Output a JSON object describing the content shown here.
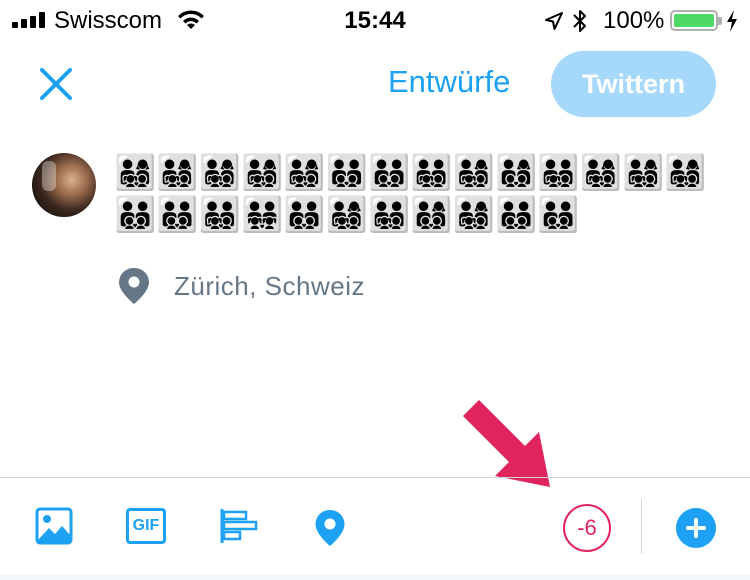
{
  "status_bar": {
    "carrier": "Swisscom",
    "time": "15:44",
    "battery": "100%"
  },
  "header": {
    "drafts_label": "Entwürfe",
    "tweet_button_label": "Twittern"
  },
  "compose": {
    "tweet_text": "👨‍👩‍👧‍👦👨‍👩‍👧‍👦👨‍👩‍👧‍👦👨‍👩‍👧‍👦👨‍👩‍👧‍👦👨‍👨‍👦‍👦👨‍👨‍👦‍👦👨‍👨‍👧‍👦👨‍👩‍👧‍👦👨‍👩‍👦‍👦👨‍👨‍👧‍👦👨‍👩‍👧‍👦👨‍👩‍👧‍👦👨‍👩‍👧‍👦👨‍👨‍👦‍👦👨‍👨‍👦‍👦👨‍👨‍👧‍👦👨‍👨‍👧‍👧👨‍👨‍👦‍👦👨‍👩‍👧‍👦👨‍👨‍👧‍👦👨‍👩‍👦‍👦👨‍👩‍👧‍👦👨‍👨‍👦‍👦👨‍👨‍👦‍👦",
    "location": "Zürich, Schweiz"
  },
  "toolbar": {
    "gif_label": "GIF",
    "char_counter": "-6"
  },
  "icons": {
    "close": "close-icon",
    "location_pin": "location-pin-icon",
    "image": "image-icon",
    "gif": "gif-icon",
    "poll": "poll-icon",
    "location": "location-icon",
    "add": "add-icon",
    "annotation": "arrow-annotation-icon"
  },
  "colors": {
    "accent": "#1da1f2",
    "accent_disabled": "#a5d8fa",
    "over_limit": "#e0245e",
    "annotation": "#e0245e",
    "muted_text": "#657786"
  }
}
